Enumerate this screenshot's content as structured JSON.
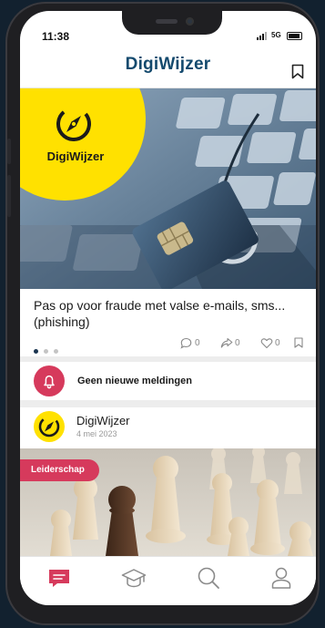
{
  "status_bar": {
    "time": "11:38",
    "network": "5G"
  },
  "header": {
    "title": "DigiWijzer",
    "bookmark_icon": "bookmark-icon"
  },
  "hero": {
    "logo_text": "DigiWijzer",
    "logo_icon": "compass-icon",
    "image": "credit-card-on-fishing-hook-over-keyboard"
  },
  "article": {
    "title": "Pas op voor fraude met valse e-mails, sms... (phishing)",
    "carousel": {
      "count": 3,
      "active": 1
    },
    "stats": {
      "comments": "0",
      "shares": "0",
      "likes": "0"
    }
  },
  "notification": {
    "text": "Geen nieuwe meldingen",
    "icon": "bell-icon"
  },
  "post": {
    "author": "DigiWijzer",
    "date": "4 mei 2023",
    "tag": "Leiderschap",
    "image": "wooden-chess-pawns"
  },
  "tab_bar": {
    "items": [
      "chat-icon",
      "graduation-cap-icon",
      "search-icon",
      "profile-icon"
    ],
    "active": 0,
    "active_color": "#d63a5c",
    "inactive_color": "#8a8a8a"
  },
  "colors": {
    "brand_blue": "#144a6e",
    "brand_yellow": "#ffe100",
    "accent": "#d63a5c"
  }
}
